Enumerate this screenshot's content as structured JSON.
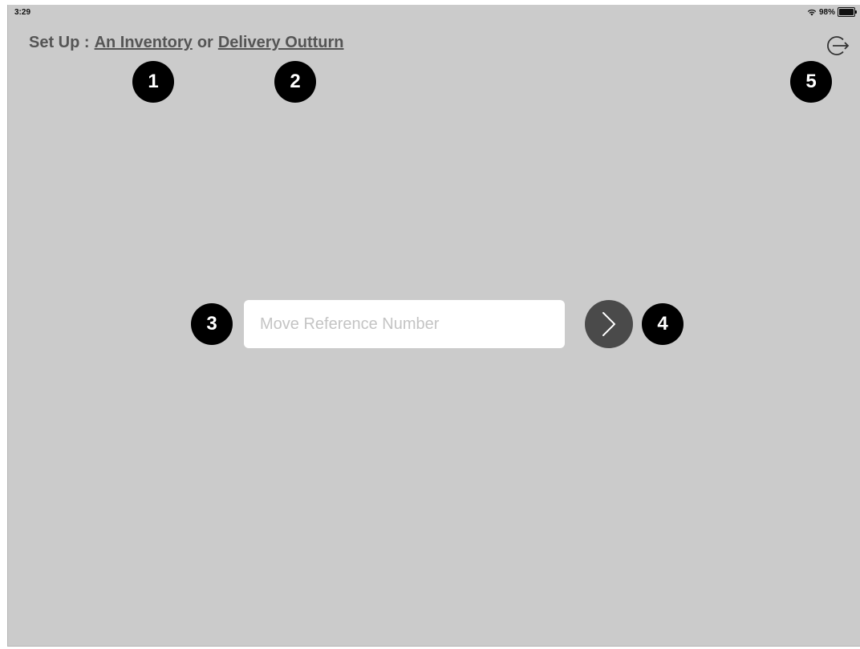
{
  "status_bar": {
    "time": "3:29",
    "battery_text": "98%",
    "battery_level": 0.98,
    "wifi_icon": "wifi-icon"
  },
  "header": {
    "prefix": "Set Up :",
    "link_inventory": "An Inventory",
    "connector": "or",
    "link_outturn": "Delivery Outturn",
    "logout_icon": "logout-icon"
  },
  "form": {
    "placeholder": "Move Reference Number",
    "value": "",
    "submit_icon": "chevron-right-icon"
  },
  "badges": [
    "1",
    "2",
    "3",
    "4",
    "5"
  ],
  "colors": {
    "background": "#cbcbcb",
    "submit_button": "#4a4a4a",
    "badge": "#000000",
    "text": "#555555"
  }
}
